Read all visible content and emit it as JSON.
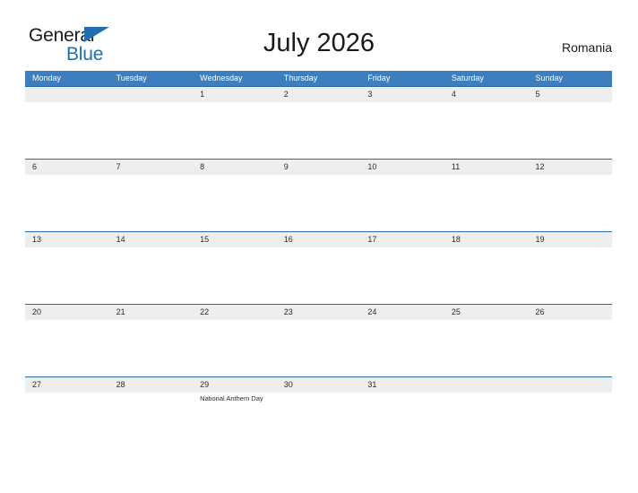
{
  "brand": {
    "name_part1": "General",
    "name_part2": "Blue",
    "triangle_color": "#1f6fb2"
  },
  "header": {
    "title": "July 2026",
    "country": "Romania"
  },
  "theme": {
    "header_blue": "#3d7ebe",
    "row_rule_blue": "#2a6aa8",
    "date_band_gray": "#eeeeee",
    "text_dark": "#2b2b2b",
    "page_background": "#ffffff"
  },
  "calendar": {
    "month": "July",
    "year": "2026",
    "weekday_headers": [
      "Monday",
      "Tuesday",
      "Wednesday",
      "Thursday",
      "Friday",
      "Saturday",
      "Sunday"
    ],
    "weeks": [
      [
        {
          "day": "",
          "event": ""
        },
        {
          "day": "",
          "event": ""
        },
        {
          "day": "1",
          "event": ""
        },
        {
          "day": "2",
          "event": ""
        },
        {
          "day": "3",
          "event": ""
        },
        {
          "day": "4",
          "event": ""
        },
        {
          "day": "5",
          "event": ""
        }
      ],
      [
        {
          "day": "6",
          "event": ""
        },
        {
          "day": "7",
          "event": ""
        },
        {
          "day": "8",
          "event": ""
        },
        {
          "day": "9",
          "event": ""
        },
        {
          "day": "10",
          "event": ""
        },
        {
          "day": "11",
          "event": ""
        },
        {
          "day": "12",
          "event": ""
        }
      ],
      [
        {
          "day": "13",
          "event": ""
        },
        {
          "day": "14",
          "event": ""
        },
        {
          "day": "15",
          "event": ""
        },
        {
          "day": "16",
          "event": ""
        },
        {
          "day": "17",
          "event": ""
        },
        {
          "day": "18",
          "event": ""
        },
        {
          "day": "19",
          "event": ""
        }
      ],
      [
        {
          "day": "20",
          "event": ""
        },
        {
          "day": "21",
          "event": ""
        },
        {
          "day": "22",
          "event": ""
        },
        {
          "day": "23",
          "event": ""
        },
        {
          "day": "24",
          "event": ""
        },
        {
          "day": "25",
          "event": ""
        },
        {
          "day": "26",
          "event": ""
        }
      ],
      [
        {
          "day": "27",
          "event": ""
        },
        {
          "day": "28",
          "event": ""
        },
        {
          "day": "29",
          "event": "National Anthem Day"
        },
        {
          "day": "30",
          "event": ""
        },
        {
          "day": "31",
          "event": ""
        },
        {
          "day": "",
          "event": ""
        },
        {
          "day": "",
          "event": ""
        }
      ]
    ]
  }
}
